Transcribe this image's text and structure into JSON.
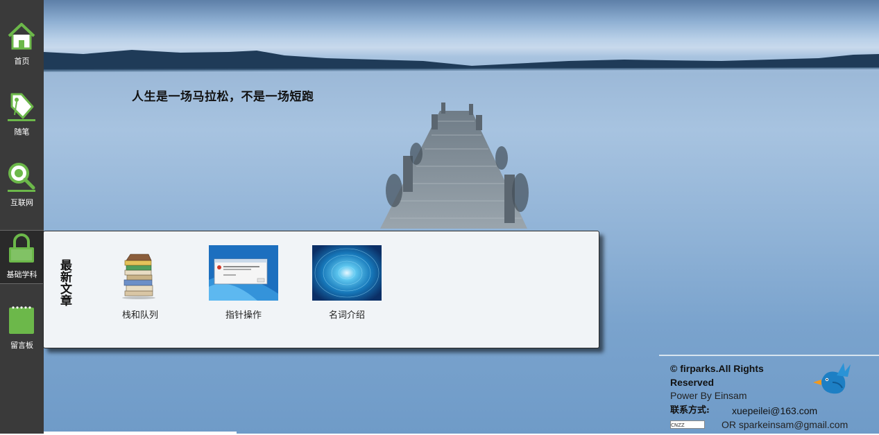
{
  "slogan": "人生是一场马拉松，不是一场短跑",
  "sidebar": {
    "items": [
      {
        "label": "首页",
        "icon": "home-icon"
      },
      {
        "label": "随笔",
        "icon": "tag-icon"
      },
      {
        "label": "互联网",
        "icon": "magnifier-icon"
      },
      {
        "label": "基础学科",
        "icon": "lock-icon"
      },
      {
        "label": "留言板",
        "icon": "notepad-icon"
      }
    ],
    "active_index": 3,
    "icon_color": "#6cb84a"
  },
  "latest": {
    "title": "最新文章",
    "articles": [
      {
        "label": "栈和队列",
        "thumb": "books-icon"
      },
      {
        "label": "指针操作",
        "thumb": "windows-dialog-thumbnail"
      },
      {
        "label": "名词介绍",
        "thumb": "tunnel-thumbnail"
      }
    ]
  },
  "footer": {
    "copyright": "© firparks.All Rights Reserved",
    "powered": "Power By Einsam",
    "contact_label": "联系方式:",
    "email1": "xuepeilei@163.com",
    "email2": "OR sparkeinsam@gmail.com",
    "counter_badge": "CNZZ",
    "logo": "blue-bird-logo"
  }
}
